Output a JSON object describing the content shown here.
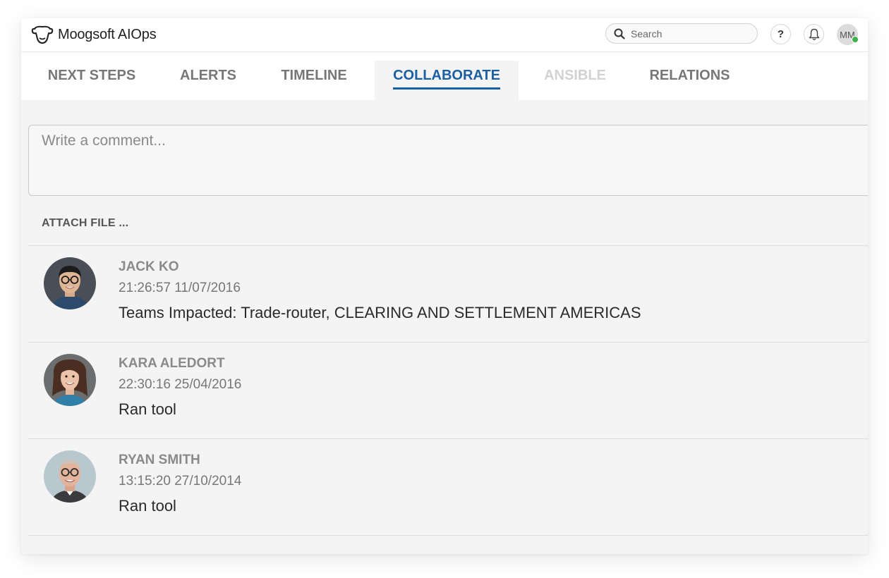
{
  "app": {
    "title": "Moogsoft AIOps",
    "logo_icon": "cow-head-icon"
  },
  "header": {
    "search_placeholder": "Search",
    "help_label": "?",
    "user_initials": "MM",
    "online_color": "#3fb14b"
  },
  "tabs": [
    {
      "label": "NEXT STEPS",
      "state": "normal"
    },
    {
      "label": "ALERTS",
      "state": "normal"
    },
    {
      "label": "TIMELINE",
      "state": "normal"
    },
    {
      "label": "COLLABORATE",
      "state": "active"
    },
    {
      "label": "ANSIBLE",
      "state": "disabled"
    },
    {
      "label": "RELATIONS",
      "state": "normal"
    }
  ],
  "colors": {
    "accent": "#1b5fa3",
    "disabled_tab": "#d2d2d2"
  },
  "composer": {
    "placeholder": "Write a comment...",
    "attach_label": "ATTACH FILE ..."
  },
  "comments": [
    {
      "author": "JACK KO",
      "timestamp": "21:26:57 11/07/2016",
      "text": "Teams Impacted: Trade-router, CLEARING AND SETTLEMENT AMERICAS"
    },
    {
      "author": "KARA ALEDORT",
      "timestamp": "22:30:16 25/04/2016",
      "text": "Ran tool"
    },
    {
      "author": "RYAN SMITH",
      "timestamp": "13:15:20 27/10/2014",
      "text": "Ran tool"
    }
  ]
}
